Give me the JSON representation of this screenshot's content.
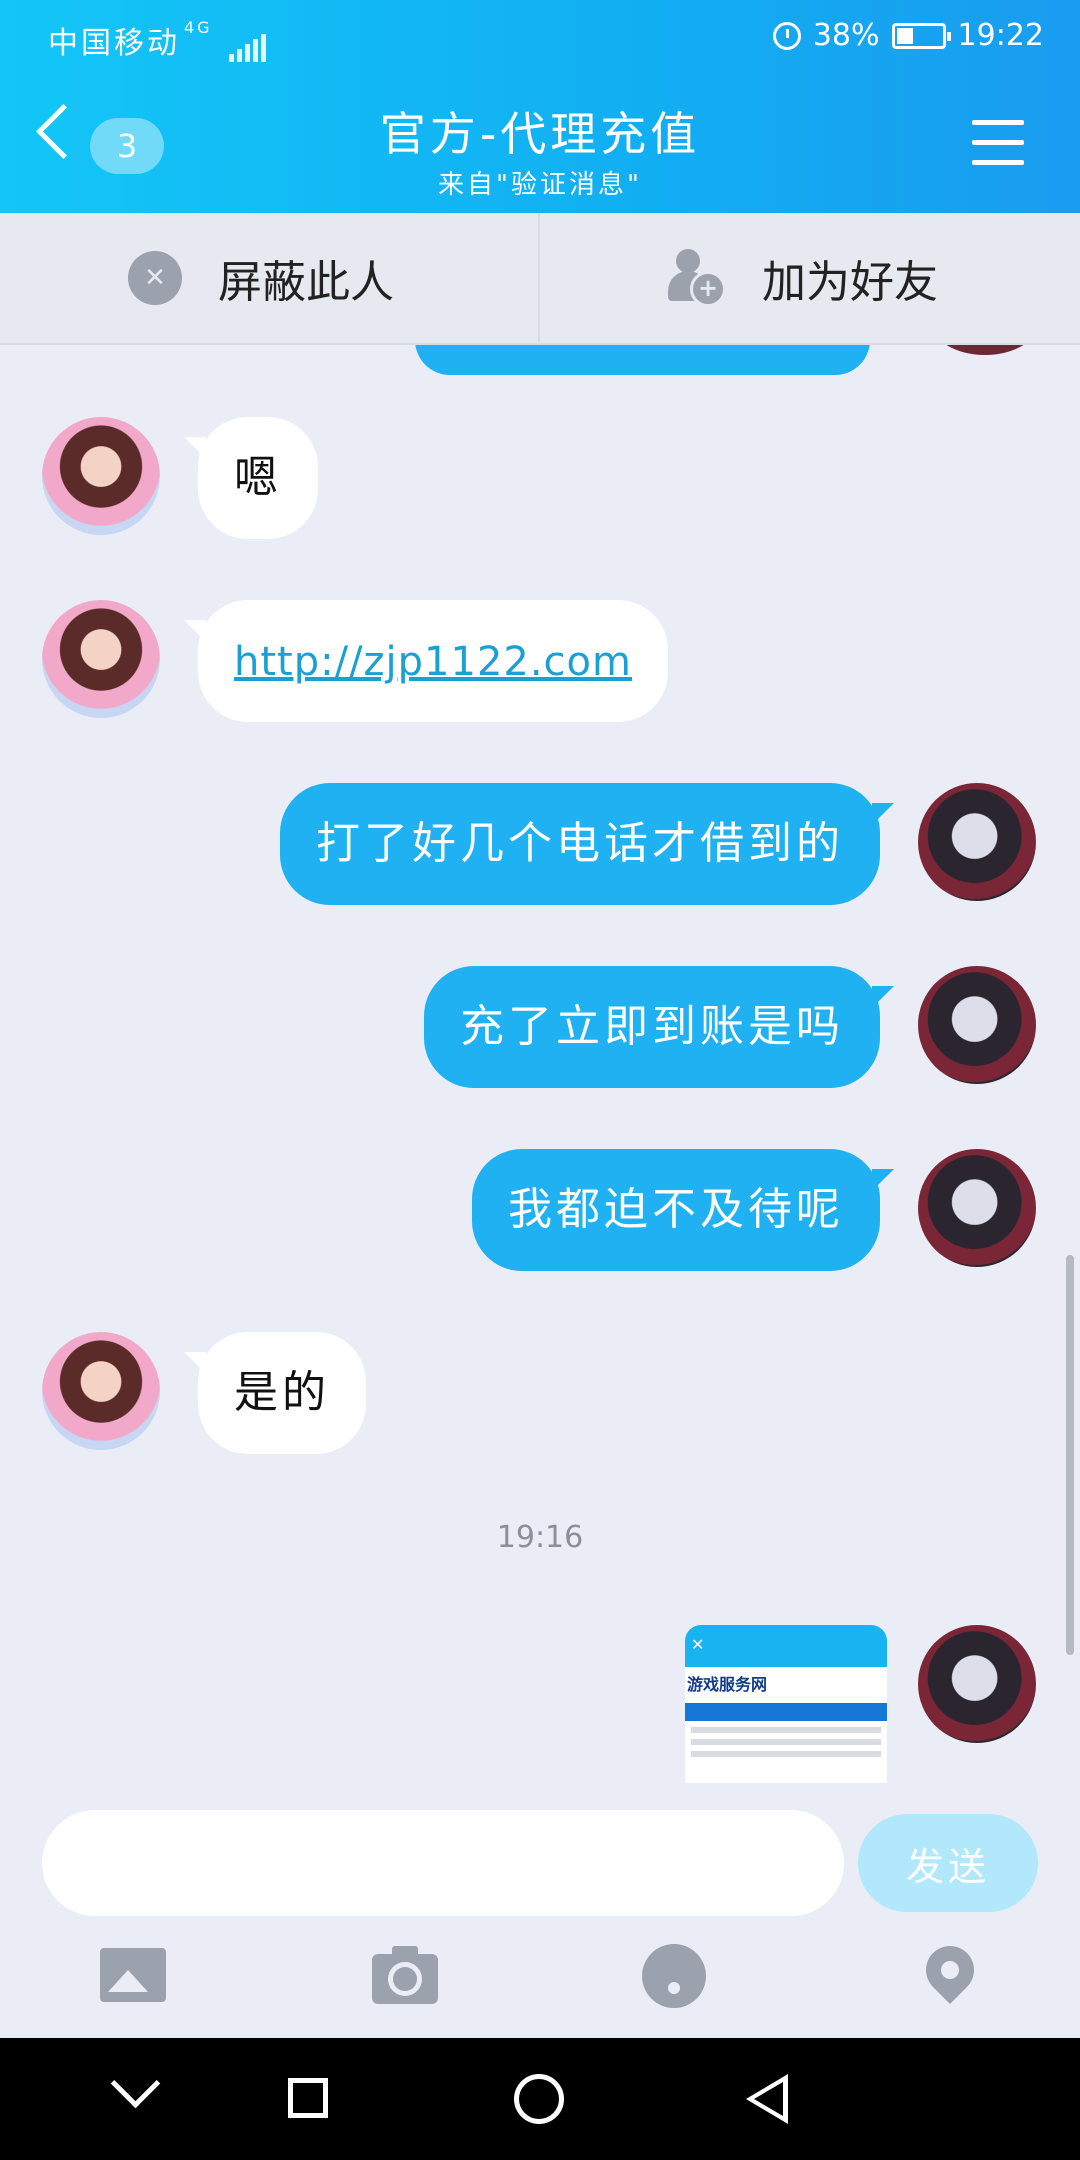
{
  "status": {
    "carrier": "中国移动",
    "network": "4G",
    "battery": "38%",
    "time": "19:22"
  },
  "header": {
    "unread_count": "3",
    "title": "官方-代理充值",
    "subtitle": "来自\"验证消息\""
  },
  "actions": {
    "block_label": "屏蔽此人",
    "add_friend_label": "加为好友"
  },
  "messages": [
    {
      "from": "them",
      "text": "嗯"
    },
    {
      "from": "them",
      "text": "http://zjp1122.com",
      "is_link": true
    },
    {
      "from": "me",
      "text": "打了好几个电话才借到的"
    },
    {
      "from": "me",
      "text": "充了立即到账是吗"
    },
    {
      "from": "me",
      "text": "我都迫不及待呢"
    },
    {
      "from": "them",
      "text": "是的"
    }
  ],
  "timestamp": "19:16",
  "screenshot_thumb": {
    "brand": "游戏服务网"
  },
  "composer": {
    "input_value": "",
    "send_label": "发送"
  },
  "icons": {
    "back": "chevron-left-icon",
    "menu": "hamburger-icon",
    "block": "block-icon",
    "add_friend": "add-friend-icon",
    "tools": [
      "image-icon",
      "camera-icon",
      "emoji-icon",
      "location-icon"
    ],
    "nav": [
      "nav-down-icon",
      "recent-apps-icon",
      "home-icon",
      "back-triangle-icon"
    ]
  },
  "colors": {
    "header": "#12aef2",
    "bubble_me": "#1fb1f1",
    "bubble_them": "#ffffff",
    "send_disabled": "#b2e8fb"
  }
}
